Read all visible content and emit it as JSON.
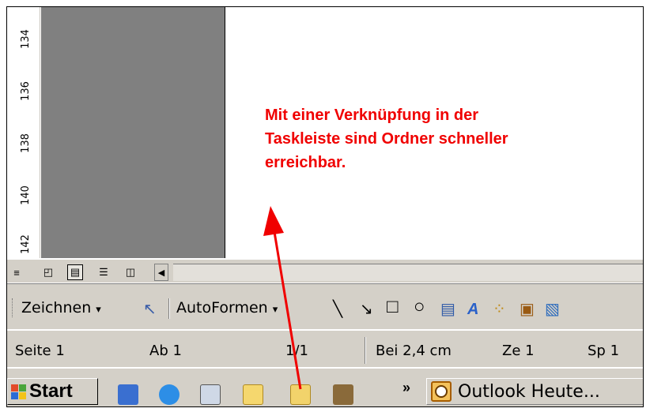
{
  "ruler": {
    "ticks": [
      "134",
      "136",
      "138",
      "140",
      "142"
    ]
  },
  "annotation": {
    "lines": [
      "Mit einer Verknüpfung in der",
      "Taskleiste sind Ordner schneller",
      "erreichbar."
    ],
    "color": "#f00000"
  },
  "view_buttons": [
    {
      "icon": "normal-view-icon",
      "glyph": "≡"
    },
    {
      "icon": "web-layout-icon",
      "glyph": "◰"
    },
    {
      "icon": "print-layout-icon",
      "glyph": "▤"
    },
    {
      "icon": "outline-view-icon",
      "glyph": "☰"
    },
    {
      "icon": "reading-layout-icon",
      "glyph": "◫"
    }
  ],
  "drawing_toolbar": {
    "zeichnen_label": "Zeichnen",
    "autoformen_label": "AutoFormen",
    "dropdown_glyph": "▾",
    "tools": [
      {
        "icon": "select-objects-icon",
        "glyph": "↖"
      },
      {
        "icon": "line-icon",
        "glyph": "╲"
      },
      {
        "icon": "arrow-icon",
        "glyph": "↘"
      },
      {
        "icon": "rectangle-icon",
        "glyph": "□"
      },
      {
        "icon": "oval-icon",
        "glyph": "○"
      },
      {
        "icon": "textbox-icon",
        "glyph": "▤"
      },
      {
        "icon": "wordart-icon",
        "glyph": "A"
      },
      {
        "icon": "diagram-icon",
        "glyph": "⁘"
      },
      {
        "icon": "clipart-icon",
        "glyph": "▣"
      },
      {
        "icon": "insert-picture-icon",
        "glyph": "▧"
      }
    ]
  },
  "status_bar": {
    "seite": "Seite 1",
    "abschnitt": "Ab 1",
    "pages": "1/1",
    "position": "Bei 2,4 cm",
    "zeile": "Ze 1",
    "spalte": "Sp 1"
  },
  "taskbar": {
    "start_label": "Start",
    "chevron": "»",
    "quick_launch": [
      {
        "icon": "outlook-express-icon",
        "color": "#3a6fd0"
      },
      {
        "icon": "internet-explorer-icon",
        "color": "#2d8ee6"
      },
      {
        "icon": "show-desktop-icon",
        "color": "#cfd8e6"
      },
      {
        "icon": "note-icon",
        "color": "#f5d76e"
      },
      {
        "icon": "folder-icon",
        "color": "#f2d36b"
      },
      {
        "icon": "tools-icon",
        "color": "#8a6a3a"
      }
    ],
    "active_task": "Outlook Heute..."
  }
}
